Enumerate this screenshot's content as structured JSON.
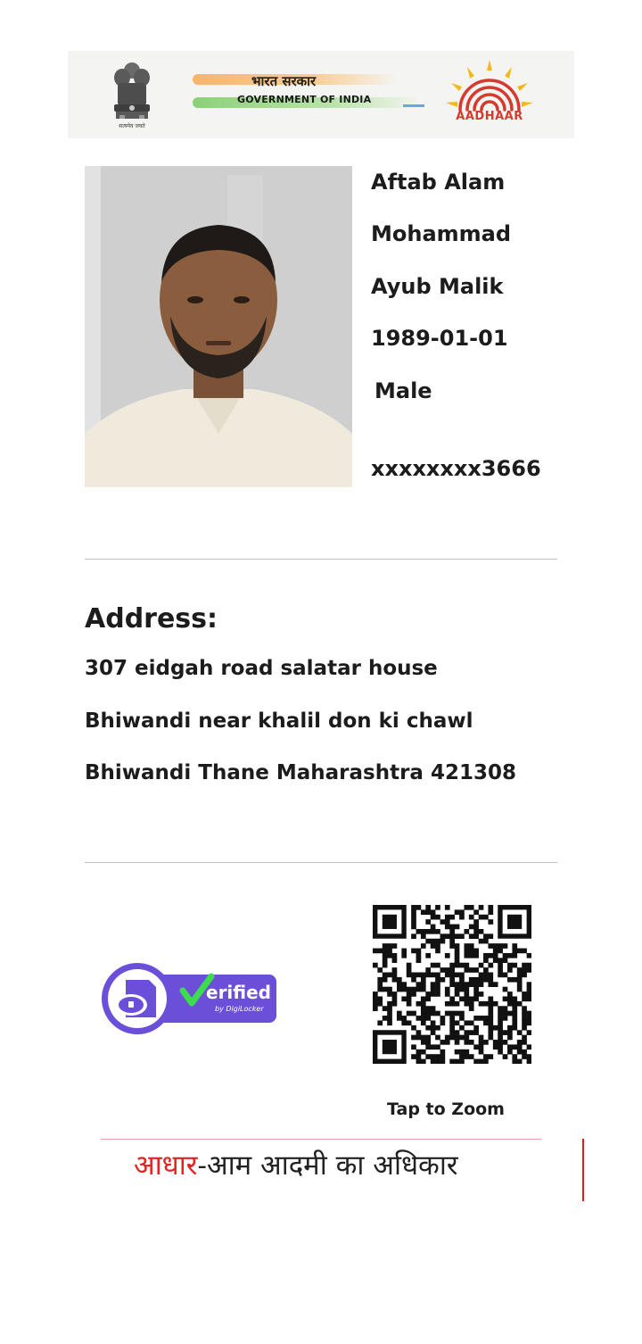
{
  "header": {
    "emblem_motto": "सत्यमेव जयते",
    "gov_hindi": "भारत सरकार",
    "gov_english": "GOVERNMENT OF INDIA",
    "aadhaar_word": "AADHAAR"
  },
  "resident": {
    "name_line1": "Aftab Alam",
    "name_line2": "Mohammad",
    "name_line3": "Ayub Malik",
    "dob": "1989-01-01",
    "gender": "Male",
    "aadhaar_masked": "xxxxxxxx3666"
  },
  "address": {
    "heading": "Address:",
    "line1": "307 eidgah road salatar house",
    "line2": "Bhiwandi near khalil don ki chawl",
    "line3": "Bhiwandi Thane Maharashtra 421308"
  },
  "badge": {
    "text": "erified",
    "sub": "by DigiLocker"
  },
  "qr": {
    "action_label": "Tap to Zoom"
  },
  "footer": {
    "tag_red": "आधार",
    "tag_rest": "-आम आदमी का अधिकार"
  },
  "colors": {
    "aadhaar_red": "#d63a2e",
    "footer_red": "#e62121",
    "badge_purple": "#6b4fd8",
    "text_dark": "#1c1c1c"
  },
  "icons": [
    "national-emblem-icon",
    "aadhaar-sun-fingerprint-icon",
    "digilocker-cloud-icon",
    "checkmark-icon",
    "qr-code"
  ]
}
